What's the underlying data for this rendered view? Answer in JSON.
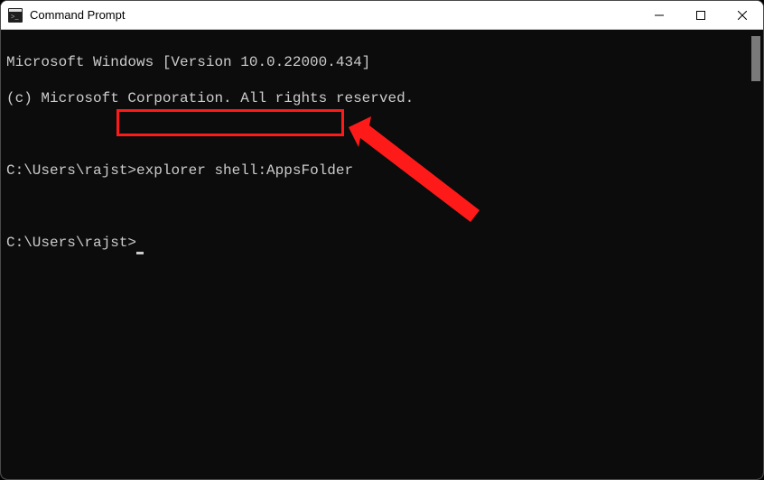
{
  "window": {
    "title": "Command Prompt"
  },
  "terminal": {
    "banner_line1": "Microsoft Windows [Version 10.0.22000.434]",
    "banner_line2": "(c) Microsoft Corporation. All rights reserved.",
    "prompt1_prefix": "C:\\Users\\rajst>",
    "prompt1_command": "explorer shell:AppsFolder",
    "prompt2_prefix": "C:\\Users\\rajst>"
  },
  "annotation": {
    "highlight_color": "#ff1a1a"
  }
}
